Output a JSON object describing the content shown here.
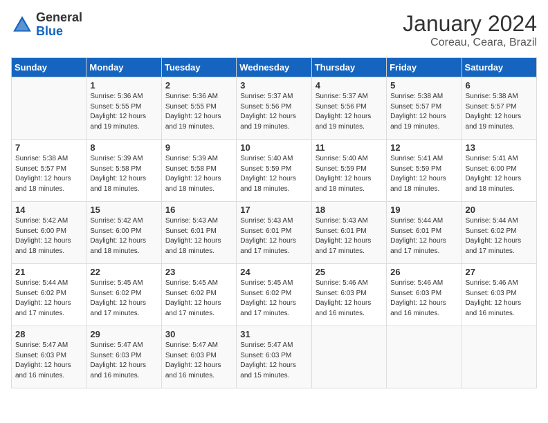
{
  "header": {
    "logo_general": "General",
    "logo_blue": "Blue",
    "month_year": "January 2024",
    "location": "Coreau, Ceara, Brazil"
  },
  "days_of_week": [
    "Sunday",
    "Monday",
    "Tuesday",
    "Wednesday",
    "Thursday",
    "Friday",
    "Saturday"
  ],
  "weeks": [
    [
      {
        "day": "",
        "info": ""
      },
      {
        "day": "1",
        "info": "Sunrise: 5:36 AM\nSunset: 5:55 PM\nDaylight: 12 hours and 19 minutes."
      },
      {
        "day": "2",
        "info": "Sunrise: 5:36 AM\nSunset: 5:55 PM\nDaylight: 12 hours and 19 minutes."
      },
      {
        "day": "3",
        "info": "Sunrise: 5:37 AM\nSunset: 5:56 PM\nDaylight: 12 hours and 19 minutes."
      },
      {
        "day": "4",
        "info": "Sunrise: 5:37 AM\nSunset: 5:56 PM\nDaylight: 12 hours and 19 minutes."
      },
      {
        "day": "5",
        "info": "Sunrise: 5:38 AM\nSunset: 5:57 PM\nDaylight: 12 hours and 19 minutes."
      },
      {
        "day": "6",
        "info": "Sunrise: 5:38 AM\nSunset: 5:57 PM\nDaylight: 12 hours and 19 minutes."
      }
    ],
    [
      {
        "day": "7",
        "info": "Sunrise: 5:38 AM\nSunset: 5:57 PM\nDaylight: 12 hours and 18 minutes."
      },
      {
        "day": "8",
        "info": "Sunrise: 5:39 AM\nSunset: 5:58 PM\nDaylight: 12 hours and 18 minutes."
      },
      {
        "day": "9",
        "info": "Sunrise: 5:39 AM\nSunset: 5:58 PM\nDaylight: 12 hours and 18 minutes."
      },
      {
        "day": "10",
        "info": "Sunrise: 5:40 AM\nSunset: 5:59 PM\nDaylight: 12 hours and 18 minutes."
      },
      {
        "day": "11",
        "info": "Sunrise: 5:40 AM\nSunset: 5:59 PM\nDaylight: 12 hours and 18 minutes."
      },
      {
        "day": "12",
        "info": "Sunrise: 5:41 AM\nSunset: 5:59 PM\nDaylight: 12 hours and 18 minutes."
      },
      {
        "day": "13",
        "info": "Sunrise: 5:41 AM\nSunset: 6:00 PM\nDaylight: 12 hours and 18 minutes."
      }
    ],
    [
      {
        "day": "14",
        "info": "Sunrise: 5:42 AM\nSunset: 6:00 PM\nDaylight: 12 hours and 18 minutes."
      },
      {
        "day": "15",
        "info": "Sunrise: 5:42 AM\nSunset: 6:00 PM\nDaylight: 12 hours and 18 minutes."
      },
      {
        "day": "16",
        "info": "Sunrise: 5:43 AM\nSunset: 6:01 PM\nDaylight: 12 hours and 18 minutes."
      },
      {
        "day": "17",
        "info": "Sunrise: 5:43 AM\nSunset: 6:01 PM\nDaylight: 12 hours and 17 minutes."
      },
      {
        "day": "18",
        "info": "Sunrise: 5:43 AM\nSunset: 6:01 PM\nDaylight: 12 hours and 17 minutes."
      },
      {
        "day": "19",
        "info": "Sunrise: 5:44 AM\nSunset: 6:01 PM\nDaylight: 12 hours and 17 minutes."
      },
      {
        "day": "20",
        "info": "Sunrise: 5:44 AM\nSunset: 6:02 PM\nDaylight: 12 hours and 17 minutes."
      }
    ],
    [
      {
        "day": "21",
        "info": "Sunrise: 5:44 AM\nSunset: 6:02 PM\nDaylight: 12 hours and 17 minutes."
      },
      {
        "day": "22",
        "info": "Sunrise: 5:45 AM\nSunset: 6:02 PM\nDaylight: 12 hours and 17 minutes."
      },
      {
        "day": "23",
        "info": "Sunrise: 5:45 AM\nSunset: 6:02 PM\nDaylight: 12 hours and 17 minutes."
      },
      {
        "day": "24",
        "info": "Sunrise: 5:45 AM\nSunset: 6:02 PM\nDaylight: 12 hours and 17 minutes."
      },
      {
        "day": "25",
        "info": "Sunrise: 5:46 AM\nSunset: 6:03 PM\nDaylight: 12 hours and 16 minutes."
      },
      {
        "day": "26",
        "info": "Sunrise: 5:46 AM\nSunset: 6:03 PM\nDaylight: 12 hours and 16 minutes."
      },
      {
        "day": "27",
        "info": "Sunrise: 5:46 AM\nSunset: 6:03 PM\nDaylight: 12 hours and 16 minutes."
      }
    ],
    [
      {
        "day": "28",
        "info": "Sunrise: 5:47 AM\nSunset: 6:03 PM\nDaylight: 12 hours and 16 minutes."
      },
      {
        "day": "29",
        "info": "Sunrise: 5:47 AM\nSunset: 6:03 PM\nDaylight: 12 hours and 16 minutes."
      },
      {
        "day": "30",
        "info": "Sunrise: 5:47 AM\nSunset: 6:03 PM\nDaylight: 12 hours and 16 minutes."
      },
      {
        "day": "31",
        "info": "Sunrise: 5:47 AM\nSunset: 6:03 PM\nDaylight: 12 hours and 15 minutes."
      },
      {
        "day": "",
        "info": ""
      },
      {
        "day": "",
        "info": ""
      },
      {
        "day": "",
        "info": ""
      }
    ]
  ]
}
